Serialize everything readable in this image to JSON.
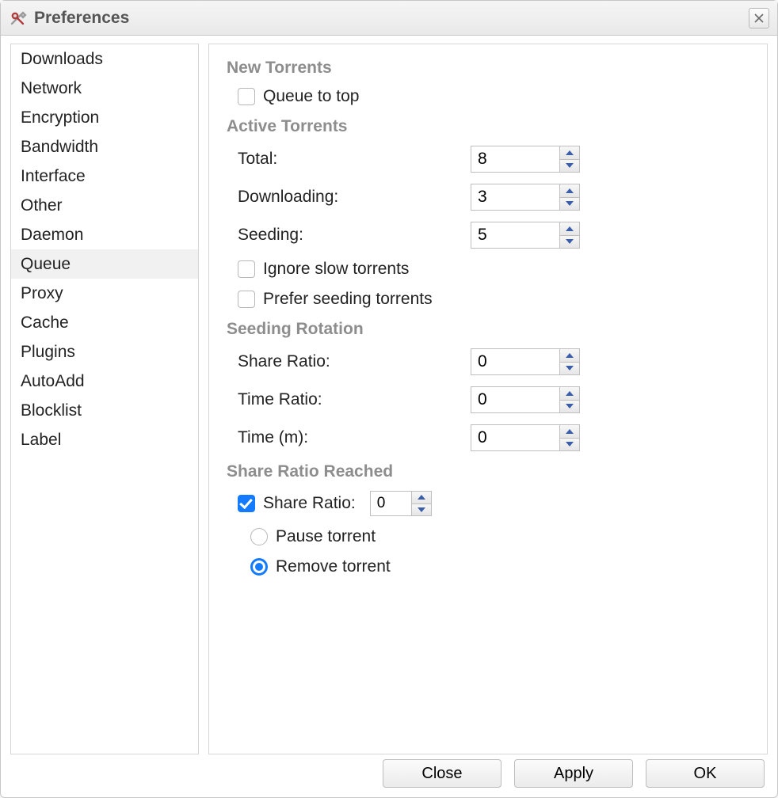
{
  "window": {
    "title": "Preferences"
  },
  "sidebar": {
    "items": [
      {
        "label": "Downloads"
      },
      {
        "label": "Network"
      },
      {
        "label": "Encryption"
      },
      {
        "label": "Bandwidth"
      },
      {
        "label": "Interface"
      },
      {
        "label": "Other"
      },
      {
        "label": "Daemon"
      },
      {
        "label": "Queue"
      },
      {
        "label": "Proxy"
      },
      {
        "label": "Cache"
      },
      {
        "label": "Plugins"
      },
      {
        "label": "AutoAdd"
      },
      {
        "label": "Blocklist"
      },
      {
        "label": "Label"
      }
    ],
    "selected_index": 7
  },
  "sections": {
    "new_torrents": {
      "header": "New Torrents",
      "queue_to_top": {
        "label": "Queue to top",
        "checked": false
      }
    },
    "active_torrents": {
      "header": "Active Torrents",
      "total": {
        "label": "Total:",
        "value": "8"
      },
      "downloading": {
        "label": "Downloading:",
        "value": "3"
      },
      "seeding": {
        "label": "Seeding:",
        "value": "5"
      },
      "ignore_slow": {
        "label": "Ignore slow torrents",
        "checked": false
      },
      "prefer_seeding": {
        "label": "Prefer seeding torrents",
        "checked": false
      }
    },
    "seeding_rotation": {
      "header": "Seeding Rotation",
      "share_ratio": {
        "label": "Share Ratio:",
        "value": "0"
      },
      "time_ratio": {
        "label": "Time Ratio:",
        "value": "0"
      },
      "time_m": {
        "label": "Time (m):",
        "value": "0"
      }
    },
    "share_ratio_reached": {
      "header": "Share Ratio Reached",
      "enable": {
        "label": "Share Ratio:",
        "checked": true,
        "value": "0"
      },
      "action_pause": {
        "label": "Pause torrent"
      },
      "action_remove": {
        "label": "Remove torrent"
      },
      "selected_action": "remove"
    }
  },
  "buttons": {
    "close": "Close",
    "apply": "Apply",
    "ok": "OK"
  }
}
